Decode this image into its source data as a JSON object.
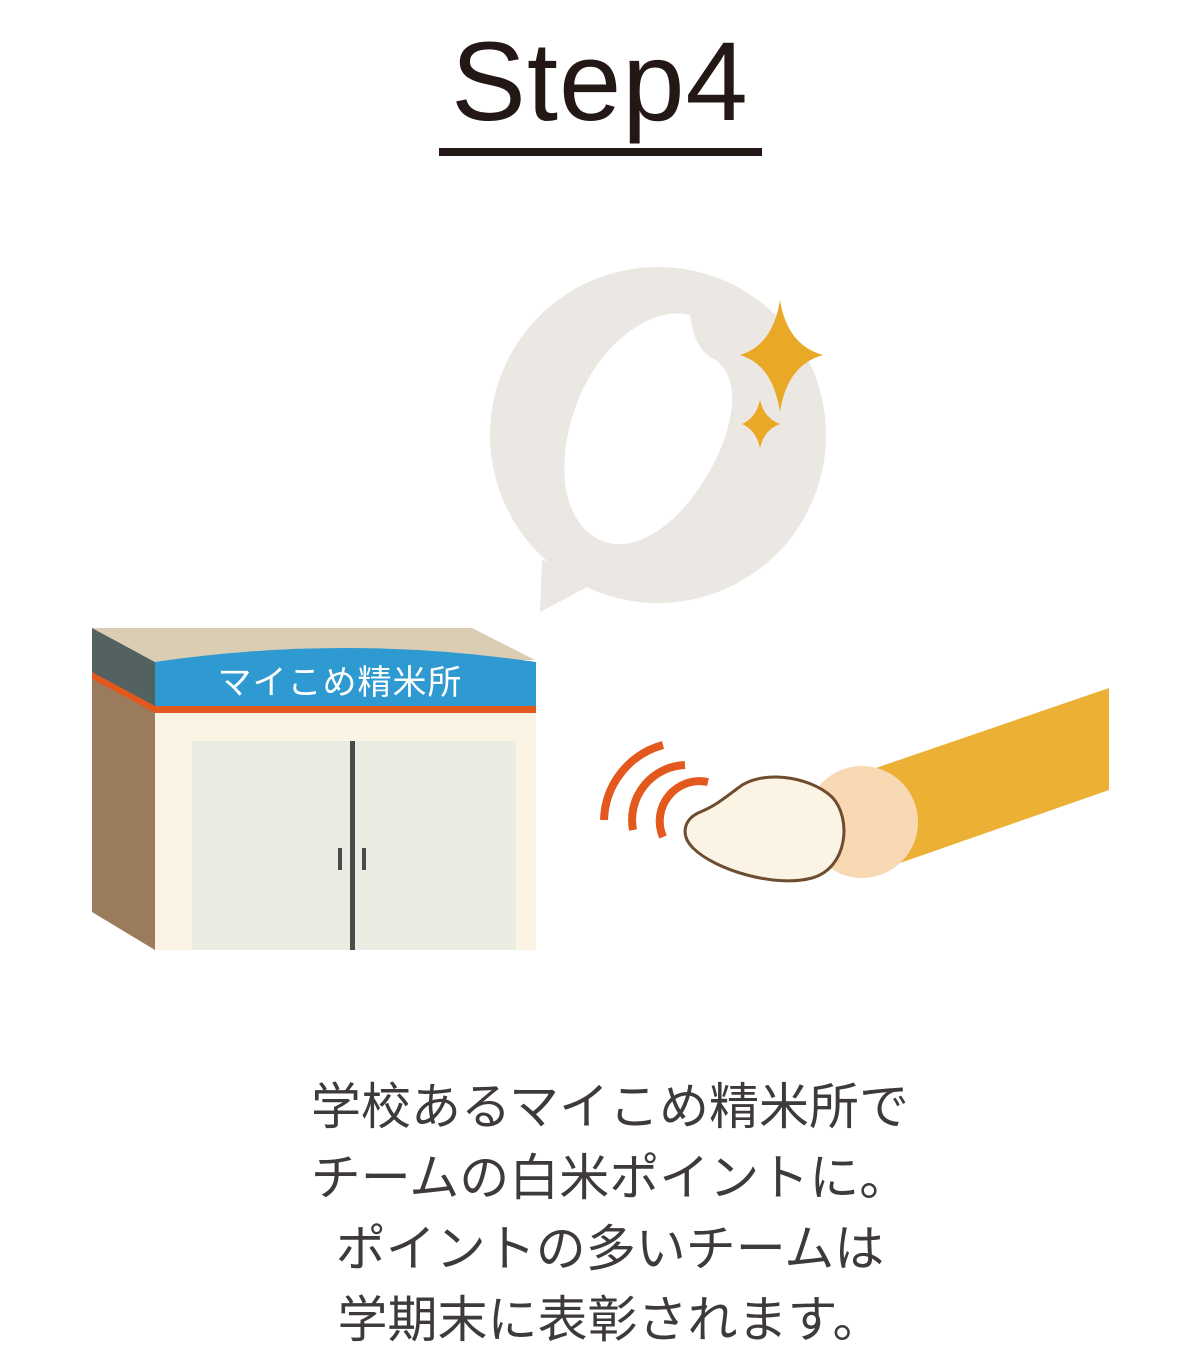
{
  "step": {
    "title": "Step4"
  },
  "store": {
    "sign": "マイこめ精米所"
  },
  "caption": {
    "lines": [
      "学校あるマイこめ精米所で",
      "チームの白米ポイントに。",
      "ポイントの多いチームは",
      "学期末に表彰されます。"
    ]
  },
  "colors": {
    "text": "#231815",
    "bubble": "#ebe7e2",
    "sparkle": "#e9a825",
    "sign_blue": "#2f9ad1",
    "sign_stripe": "#e2581d",
    "signal": "#e2581d",
    "sleeve": "#ebb034",
    "hand": "#f8d9b3",
    "card": "#fbf3e4"
  },
  "icons": [
    "speech-bubble-icon",
    "rice-grain-icon",
    "sparkle-icon",
    "store-icon",
    "signal-waves-icon",
    "rice-card-icon",
    "arm-icon"
  ]
}
